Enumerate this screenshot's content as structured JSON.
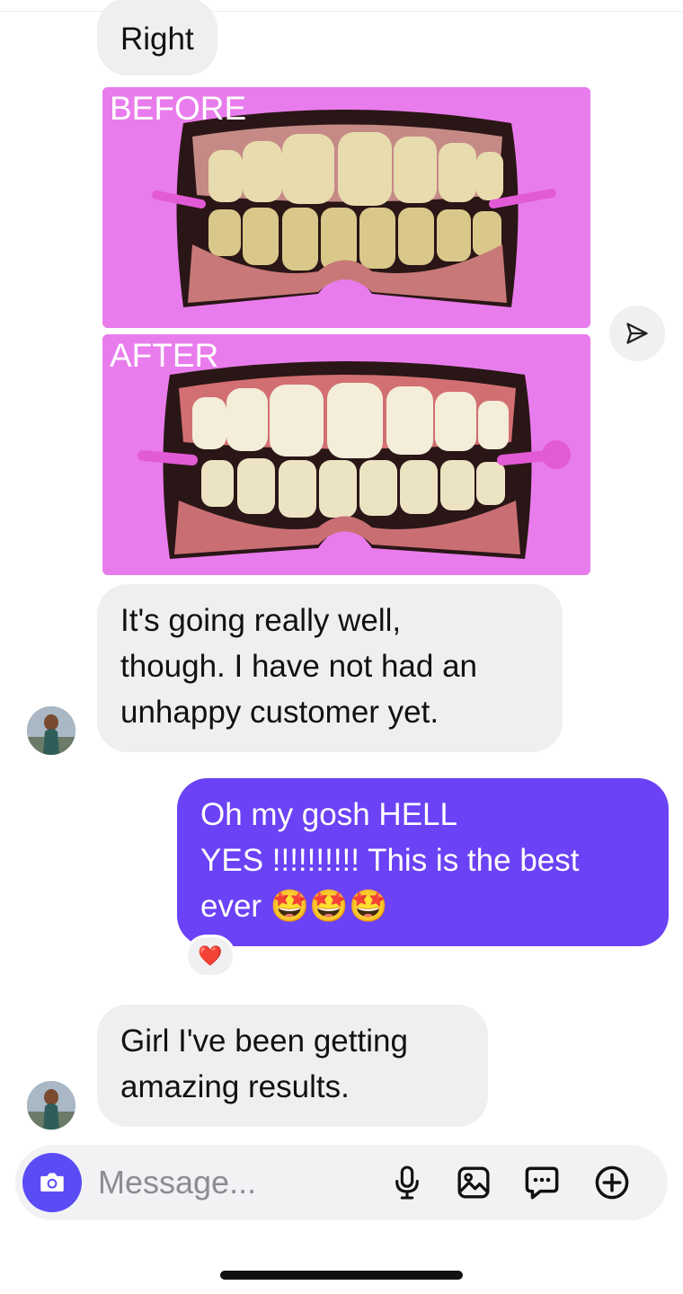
{
  "messages": [
    {
      "sender": "them",
      "text": "Right"
    },
    {
      "sender": "them",
      "type": "image",
      "labels": [
        "BEFORE",
        "AFTER"
      ]
    },
    {
      "sender": "them",
      "text": "It's going really well,\nthough. I have not had an\nunhappy customer yet."
    },
    {
      "sender": "me",
      "text": "Oh my gosh HELL\nYES !!!!!!!!!! This is the best\never 🤩🤩🤩",
      "reaction": "❤️"
    },
    {
      "sender": "them",
      "text": "Girl I've been getting\namazing results."
    }
  ],
  "composer": {
    "placeholder": "Message...",
    "icons": [
      "camera-icon",
      "microphone-icon",
      "gallery-icon",
      "sticker-icon",
      "add-icon"
    ]
  },
  "colors": {
    "outgoing_bubble": "#6b42f5",
    "incoming_bubble": "#efeff1",
    "camera_button": "#5a4cf5",
    "photo_background": "#e879ec"
  }
}
